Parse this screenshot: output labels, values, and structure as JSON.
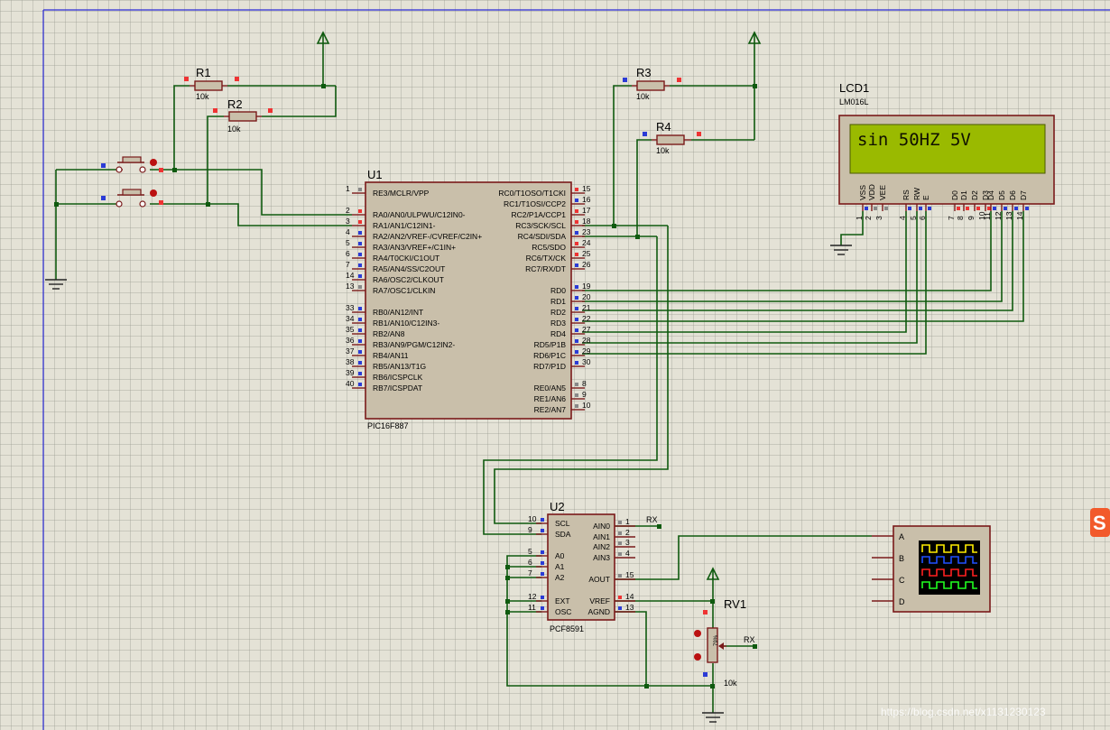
{
  "u1": {
    "ref": "U1",
    "part": "PIC16F887",
    "left_pins": [
      {
        "num": "1",
        "name": "RE3/MCLR/VPP"
      },
      {
        "num": "2",
        "name": "RA0/AN0/ULPWU/C12IN0-"
      },
      {
        "num": "3",
        "name": "RA1/AN1/C12IN1-"
      },
      {
        "num": "4",
        "name": "RA2/AN2/VREF-/CVREF/C2IN+"
      },
      {
        "num": "5",
        "name": "RA3/AN3/VREF+/C1IN+"
      },
      {
        "num": "6",
        "name": "RA4/T0CKI/C1OUT"
      },
      {
        "num": "7",
        "name": "RA5/AN4/SS/C2OUT"
      },
      {
        "num": "14",
        "name": "RA6/OSC2/CLKOUT"
      },
      {
        "num": "13",
        "name": "RA7/OSC1/CLKIN"
      },
      {
        "num": "33",
        "name": "RB0/AN12/INT"
      },
      {
        "num": "34",
        "name": "RB1/AN10/C12IN3-"
      },
      {
        "num": "35",
        "name": "RB2/AN8"
      },
      {
        "num": "36",
        "name": "RB3/AN9/PGM/C12IN2-"
      },
      {
        "num": "37",
        "name": "RB4/AN11"
      },
      {
        "num": "38",
        "name": "RB5/AN13/T1G"
      },
      {
        "num": "39",
        "name": "RB6/ICSPCLK"
      },
      {
        "num": "40",
        "name": "RB7/ICSPDAT"
      }
    ],
    "right_pins": [
      {
        "num": "15",
        "name": "RC0/T1OSO/T1CKI"
      },
      {
        "num": "16",
        "name": "RC1/T1OSI/CCP2"
      },
      {
        "num": "17",
        "name": "RC2/P1A/CCP1"
      },
      {
        "num": "18",
        "name": "RC3/SCK/SCL"
      },
      {
        "num": "23",
        "name": "RC4/SDI/SDA"
      },
      {
        "num": "24",
        "name": "RC5/SDO"
      },
      {
        "num": "25",
        "name": "RC6/TX/CK"
      },
      {
        "num": "26",
        "name": "RC7/RX/DT"
      },
      {
        "num": "19",
        "name": "RD0"
      },
      {
        "num": "20",
        "name": "RD1"
      },
      {
        "num": "21",
        "name": "RD2"
      },
      {
        "num": "22",
        "name": "RD3"
      },
      {
        "num": "27",
        "name": "RD4"
      },
      {
        "num": "28",
        "name": "RD5/P1B"
      },
      {
        "num": "29",
        "name": "RD6/P1C"
      },
      {
        "num": "30",
        "name": "RD7/P1D"
      },
      {
        "num": "8",
        "name": "RE0/AN5"
      },
      {
        "num": "9",
        "name": "RE1/AN6"
      },
      {
        "num": "10",
        "name": "RE2/AN7"
      }
    ]
  },
  "resistors": [
    {
      "ref": "R1",
      "value": "10k"
    },
    {
      "ref": "R2",
      "value": "10k"
    },
    {
      "ref": "R3",
      "value": "10k"
    },
    {
      "ref": "R4",
      "value": "10k"
    }
  ],
  "lcd": {
    "ref": "LCD1",
    "part": "LM016L",
    "display_text": "sin 50HZ 5V",
    "pins": [
      {
        "num": "1",
        "name": "VSS"
      },
      {
        "num": "2",
        "name": "VDD"
      },
      {
        "num": "3",
        "name": "VEE"
      },
      {
        "num": "4",
        "name": "RS"
      },
      {
        "num": "5",
        "name": "RW"
      },
      {
        "num": "6",
        "name": "E"
      },
      {
        "num": "7",
        "name": "D0"
      },
      {
        "num": "8",
        "name": "D1"
      },
      {
        "num": "9",
        "name": "D2"
      },
      {
        "num": "10",
        "name": "D3"
      },
      {
        "num": "11",
        "name": "D4"
      },
      {
        "num": "12",
        "name": "D5"
      },
      {
        "num": "13",
        "name": "D6"
      },
      {
        "num": "14",
        "name": "D7"
      }
    ]
  },
  "u2": {
    "ref": "U2",
    "part": "PCF8591",
    "left_pins": [
      {
        "num": "10",
        "name": "SCL"
      },
      {
        "num": "9",
        "name": "SDA"
      },
      {
        "num": "5",
        "name": "A0"
      },
      {
        "num": "6",
        "name": "A1"
      },
      {
        "num": "7",
        "name": "A2"
      },
      {
        "num": "12",
        "name": "EXT"
      },
      {
        "num": "11",
        "name": "OSC"
      }
    ],
    "right_pins": [
      {
        "num": "1",
        "name": "AIN0"
      },
      {
        "num": "2",
        "name": "AIN1"
      },
      {
        "num": "3",
        "name": "AIN2"
      },
      {
        "num": "4",
        "name": "AIN3"
      },
      {
        "num": "15",
        "name": "AOUT"
      },
      {
        "num": "14",
        "name": "VREF"
      },
      {
        "num": "13",
        "name": "AGND"
      }
    ]
  },
  "pot": {
    "ref": "RV1",
    "value": "10k",
    "percent_label": "79%"
  },
  "rx_labels": [
    "RX",
    "RX"
  ],
  "scope": {
    "channels": [
      "A",
      "B",
      "C",
      "D"
    ]
  },
  "watermark": "https://blog.csdn.net/x1131230123",
  "colors": {
    "wire": "#0f5a0f",
    "component": "#7a1a1a",
    "body_fill": "#c9bfaa",
    "lcd_screen": "#9aba00"
  },
  "icons": {
    "logo": "csdn-s-logo-icon"
  }
}
